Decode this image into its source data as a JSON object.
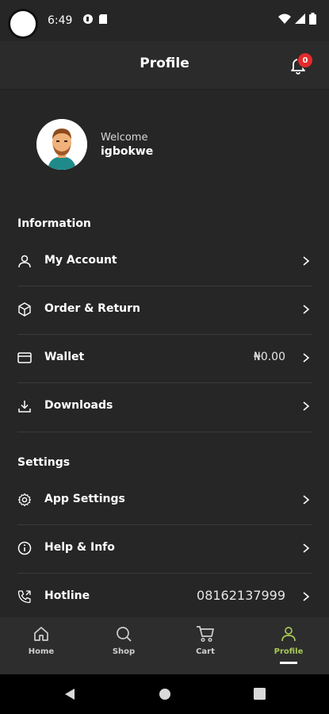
{
  "status_bar": {
    "time": "6:49"
  },
  "app_bar": {
    "title": "Profile",
    "notification_count": "0"
  },
  "profile": {
    "welcome": "Welcome",
    "username": "igbokwe"
  },
  "sections": {
    "information": {
      "title": "Information",
      "items": [
        {
          "label": "My Account",
          "icon": "user-icon"
        },
        {
          "label": "Order & Return",
          "icon": "box-icon"
        },
        {
          "label": "Wallet",
          "icon": "card-icon",
          "value": "₦0.00"
        },
        {
          "label": "Downloads",
          "icon": "download-icon"
        }
      ]
    },
    "settings": {
      "title": "Settings",
      "items": [
        {
          "label": "App Settings",
          "icon": "gear-icon"
        },
        {
          "label": "Help & Info",
          "icon": "info-icon"
        },
        {
          "label": "Hotline",
          "icon": "phone-icon",
          "value": "08162137999"
        }
      ]
    }
  },
  "bottom_nav": {
    "items": [
      {
        "label": "Home",
        "icon": "home-icon"
      },
      {
        "label": "Shop",
        "icon": "search-icon"
      },
      {
        "label": "Cart",
        "icon": "cart-icon"
      },
      {
        "label": "Profile",
        "icon": "person-icon",
        "active": true
      }
    ]
  },
  "colors": {
    "background": "#262626",
    "accent": "#a7c957",
    "badge": "#e32b2b"
  }
}
